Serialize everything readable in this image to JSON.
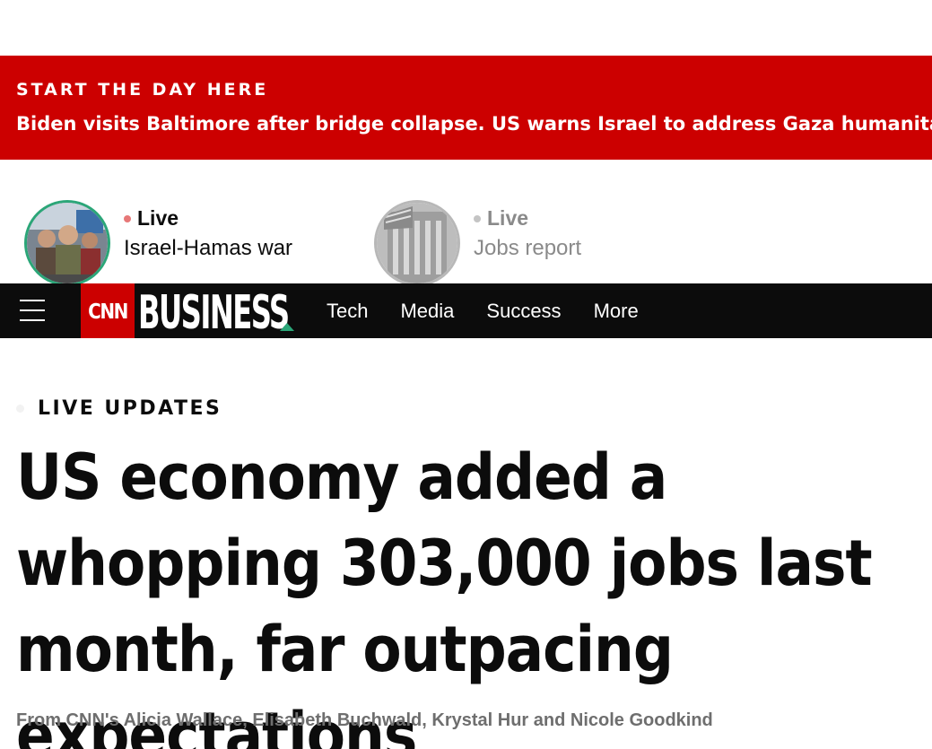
{
  "banner": {
    "kicker": "START THE DAY HERE",
    "headline": "Biden visits Baltimore after bridge collapse. US warns Israel to address Gaza humanitarian crisis",
    "color": "#cc0000"
  },
  "live_strip": [
    {
      "label": "Live",
      "title": "Israel-Hamas war",
      "thumb_icon": "news-photo-children-icon"
    },
    {
      "label": "Live",
      "title": "Jobs report",
      "thumb_icon": "stock-exchange-photo-icon"
    }
  ],
  "nav": {
    "menu_icon": "hamburger-menu-icon",
    "logo_text": "CNN",
    "section_title": "BUSINESS",
    "links": [
      "Tech",
      "Media",
      "Success",
      "More"
    ],
    "accent_color": "#2ba678"
  },
  "article": {
    "kicker": "LIVE UPDATES",
    "headline": "US economy added a whopping 303,000 jobs last month, far outpacing expectations",
    "byline": "From CNN's Alicia Wallace, Elisabeth Buchwald, Krystal Hur and Nicole Goodkind"
  }
}
